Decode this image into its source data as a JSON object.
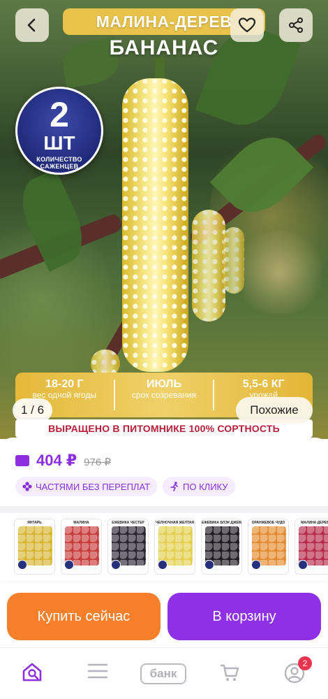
{
  "hero": {
    "title_tag": "МАЛИНА-ДЕРЕВ",
    "subtitle": "БАНАНАС",
    "badge": {
      "number": "2",
      "unit": "ШТ",
      "caption": "КОЛИЧЕСТВО САЖЕНЦЕВ"
    },
    "info": [
      {
        "big": "18-20 Г",
        "small": "вес одной ягоды"
      },
      {
        "big": "ИЮЛЬ",
        "small": "срок созревания"
      },
      {
        "big": "5,5-6 КГ",
        "small": "урожай"
      }
    ],
    "cert": "ВЫРАЩЕНО В ПИТОМНИКЕ 100% СОРТНОСТЬ",
    "pager": "1 / 6",
    "similar": "Похожие"
  },
  "price": {
    "current": "404 ₽",
    "old": "976 ₽",
    "chips": [
      {
        "label": "ЧАСТЯМИ БЕЗ ПЕРЕПЛАТ",
        "icon": "plus-cluster-icon"
      },
      {
        "label": "ПО КЛИКУ",
        "icon": "runner-icon"
      }
    ]
  },
  "thumbs": [
    {
      "label": "ЯНТАРЬ",
      "color": "#d9b632"
    },
    {
      "label": "МАЛИНА",
      "color": "#c93b3b"
    },
    {
      "label": "ЕЖЕВИКА ЧЕСТЕР",
      "color": "#2b2431"
    },
    {
      "label": "ЧЕЛНОЧНАЯ ЖЕЛТАЯ",
      "color": "#e3cf4e"
    },
    {
      "label": "ЕЖЕВИКА БЛЭК ДЖЕМ",
      "color": "#1f1a24"
    },
    {
      "label": "ОРАНЖЕВОЕ ЧУДО",
      "color": "#e38a2e"
    },
    {
      "label": "МАЛИНА ДЕРЕВ",
      "color": "#b62a4a"
    }
  ],
  "actions": {
    "buy": "Купить сейчас",
    "cart": "В корзину"
  },
  "nav": {
    "bank": "банк",
    "cart_badge": "2"
  },
  "colors": {
    "accent": "#8f2fe6",
    "buy": "#f57f2a",
    "price": "#8b2fe0",
    "cert": "#b7203a"
  }
}
